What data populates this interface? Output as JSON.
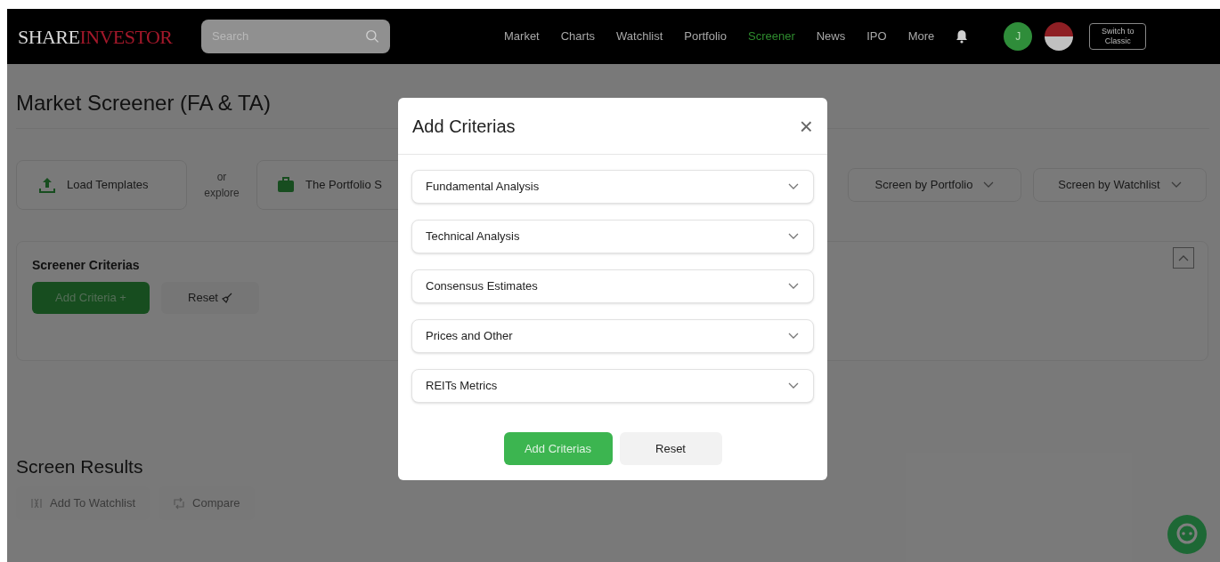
{
  "header": {
    "logo": {
      "part_1": "SHARE",
      "part_2": "INVESTOR"
    },
    "search": {
      "placeholder": "Search"
    },
    "nav": [
      {
        "label": "Market",
        "selected": false
      },
      {
        "label": "Charts",
        "selected": false
      },
      {
        "label": "Watchlist",
        "selected": false
      },
      {
        "label": "Portfolio",
        "selected": false
      },
      {
        "label": "Screener",
        "selected": true
      },
      {
        "label": "News",
        "selected": false
      },
      {
        "label": "IPO",
        "selected": false
      },
      {
        "label": "More",
        "selected": false
      }
    ],
    "avatar": "J",
    "switch_button": "Switch to Classic"
  },
  "page_title": "Market Screener (FA & TA)",
  "toolbar": {
    "load_templates": "Load Templates",
    "or_explore": "or explore",
    "portfolio_template": "The Portfolio S",
    "screen_by": [
      "Screen by Portfolio",
      "Screen by Watchlist"
    ]
  },
  "criteria_panel": {
    "title": "Screener Criterias",
    "add_button": "Add Criteria +",
    "reset_button": "Reset"
  },
  "results": {
    "title": "Screen Results",
    "actions": [
      {
        "label": "Add To Watchlist",
        "kind": "watchlist"
      },
      {
        "label": "Compare",
        "kind": "compare"
      }
    ]
  },
  "modal": {
    "title": "Add Criterias",
    "close": "×",
    "sections": [
      {
        "label": "Fundamental Analysis",
        "expanded": false
      },
      {
        "label": "Technical Analysis",
        "expanded": false
      },
      {
        "label": "Consensus Estimates",
        "expanded": false
      },
      {
        "label": "Prices and Other",
        "expanded": false
      },
      {
        "label": "REITs Metrics",
        "expanded": false
      }
    ],
    "buttons": [
      {
        "label": "Add Criterias",
        "kind": "primary"
      },
      {
        "label": "Reset",
        "kind": "secondary"
      }
    ]
  }
}
